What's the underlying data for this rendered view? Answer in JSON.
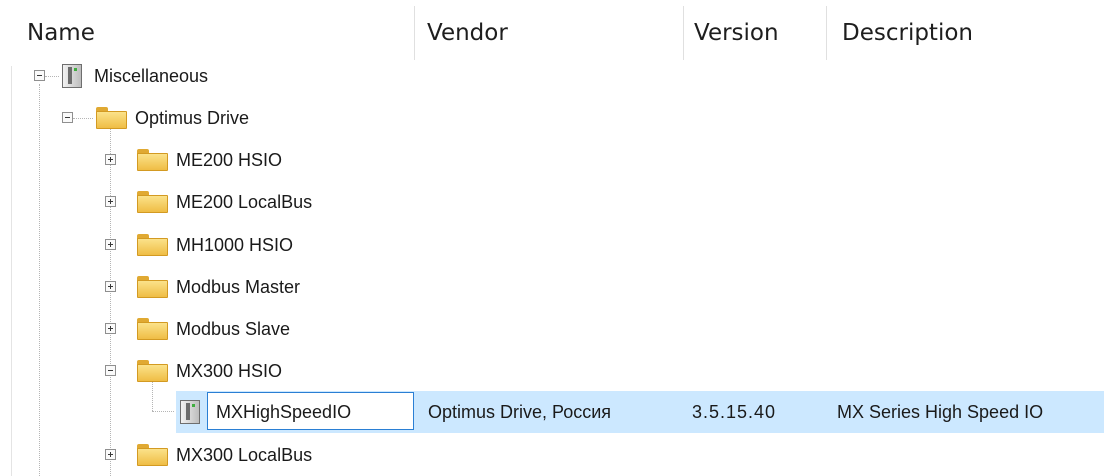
{
  "columns": {
    "name": "Name",
    "vendor": "Vendor",
    "version": "Version",
    "description": "Description"
  },
  "tree": {
    "root": {
      "label": "Miscellaneous",
      "expanded": true,
      "icon": "device-icon"
    },
    "optimus": {
      "label": "Optimus Drive",
      "expanded": true,
      "icon": "folder-icon"
    },
    "children": [
      {
        "label": "ME200 HSIO",
        "expanded": false
      },
      {
        "label": "ME200 LocalBus",
        "expanded": false
      },
      {
        "label": "MH1000 HSIO",
        "expanded": false
      },
      {
        "label": "Modbus Master",
        "expanded": false
      },
      {
        "label": "Modbus Slave",
        "expanded": false
      },
      {
        "label": "MX300 HSIO",
        "expanded": true
      },
      {
        "label": "MX300 LocalBus",
        "expanded": false
      }
    ],
    "selected_device": {
      "name": "MXHighSpeedIO",
      "vendor": "Optimus Drive, Россия",
      "version": "3.5.15.40",
      "description": "MX Series High Speed IO",
      "icon": "device-icon"
    }
  },
  "colors": {
    "selection": "#cce8ff",
    "edit_border": "#2a7fd4",
    "folder": "#f2c14e"
  }
}
